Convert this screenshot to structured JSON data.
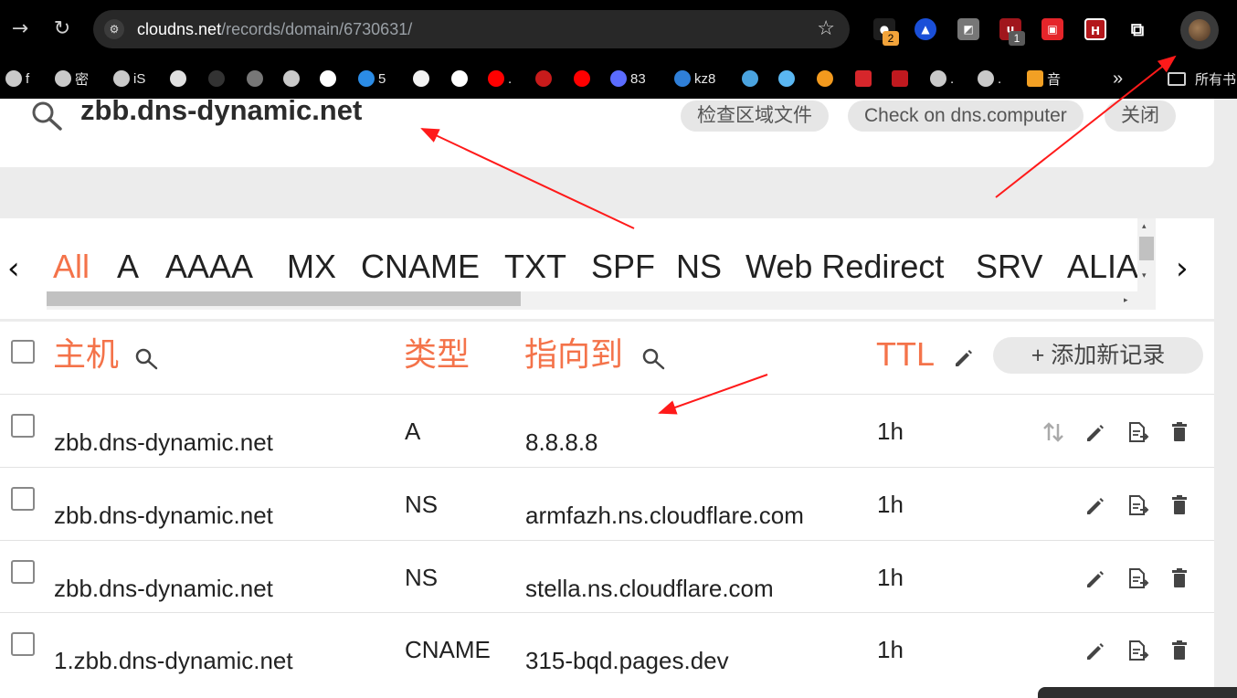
{
  "browser": {
    "url_host": "cloudns.net",
    "url_path": "/records/domain/6730631/",
    "extensions": [
      {
        "icon": "extension-badge-icon",
        "badge": "2"
      },
      {
        "icon": "extension-triangle-icon"
      },
      {
        "icon": "extension-square-icon"
      },
      {
        "icon": "ublock-icon",
        "badge": "1"
      },
      {
        "icon": "extension-red-icon"
      },
      {
        "icon": "extension-h-icon",
        "text": "H"
      },
      {
        "icon": "extensions-puzzle-icon"
      }
    ],
    "bookmarks": [
      {
        "icon": "globe-icon",
        "label": "f"
      },
      {
        "icon": "globe-icon",
        "label": "密"
      },
      {
        "icon": "globe-icon",
        "label": "iS"
      },
      {
        "icon": "openai-icon",
        "label": ""
      },
      {
        "icon": "terminal-icon",
        "label": ""
      },
      {
        "icon": "spider-icon",
        "label": ""
      },
      {
        "icon": "globe-icon",
        "label": ""
      },
      {
        "icon": "gmail-icon",
        "label": ""
      },
      {
        "icon": "onedrive-icon",
        "label": "5"
      },
      {
        "icon": "github-icon",
        "label": ""
      },
      {
        "icon": "google-icon",
        "label": ""
      },
      {
        "icon": "youtube-icon",
        "label": "."
      },
      {
        "icon": "red-glyph-icon",
        "label": ""
      },
      {
        "icon": "youtube-icon",
        "label": ""
      },
      {
        "icon": "c-icon",
        "label": "83"
      },
      {
        "icon": "kz-icon",
        "label": "kz8"
      },
      {
        "icon": "network-icon",
        "label": ""
      },
      {
        "icon": "cluster-icon",
        "label": ""
      },
      {
        "icon": "orange-icon",
        "label": ""
      },
      {
        "icon": "red-square-icon",
        "label": ""
      },
      {
        "icon": "red-stamp-icon",
        "label": ""
      },
      {
        "icon": "globe-icon",
        "label": "."
      },
      {
        "icon": "globe-icon",
        "label": "."
      },
      {
        "icon": "st-icon",
        "label": "音"
      }
    ],
    "more_bookmarks": "»",
    "all_bookmarks": "所有书"
  },
  "search": {
    "domain": "zbb.dns-dynamic.net",
    "buttons": [
      "检查区域文件",
      "Check on dns.computer",
      "关闭"
    ]
  },
  "tabs": [
    "All",
    "A",
    "AAAA",
    "MX",
    "CNAME",
    "TXT",
    "SPF",
    "NS",
    "Web Redirect",
    "SRV",
    "ALIAS"
  ],
  "active_tab": "All",
  "table": {
    "headers": {
      "host": "主机",
      "type": "类型",
      "points_to": "指向到",
      "ttl": "TTL"
    },
    "add_button": "+ 添加新记录",
    "rows": [
      {
        "host": "zbb.dns-dynamic.net",
        "type": "A",
        "points_to": "8.8.8.8",
        "ttl": "1h",
        "has_priority": true
      },
      {
        "host": "zbb.dns-dynamic.net",
        "type": "NS",
        "points_to": "armfazh.ns.cloudflare.com",
        "ttl": "1h",
        "has_priority": false
      },
      {
        "host": "zbb.dns-dynamic.net",
        "type": "NS",
        "points_to": "stella.ns.cloudflare.com",
        "ttl": "1h",
        "has_priority": false
      },
      {
        "host": "1.zbb.dns-dynamic.net",
        "type": "CNAME",
        "points_to": "315-bqd.pages.dev",
        "ttl": "1h",
        "has_priority": false
      }
    ]
  },
  "colors": {
    "accent": "#f4734a",
    "annotation": "#ff1a1a"
  }
}
